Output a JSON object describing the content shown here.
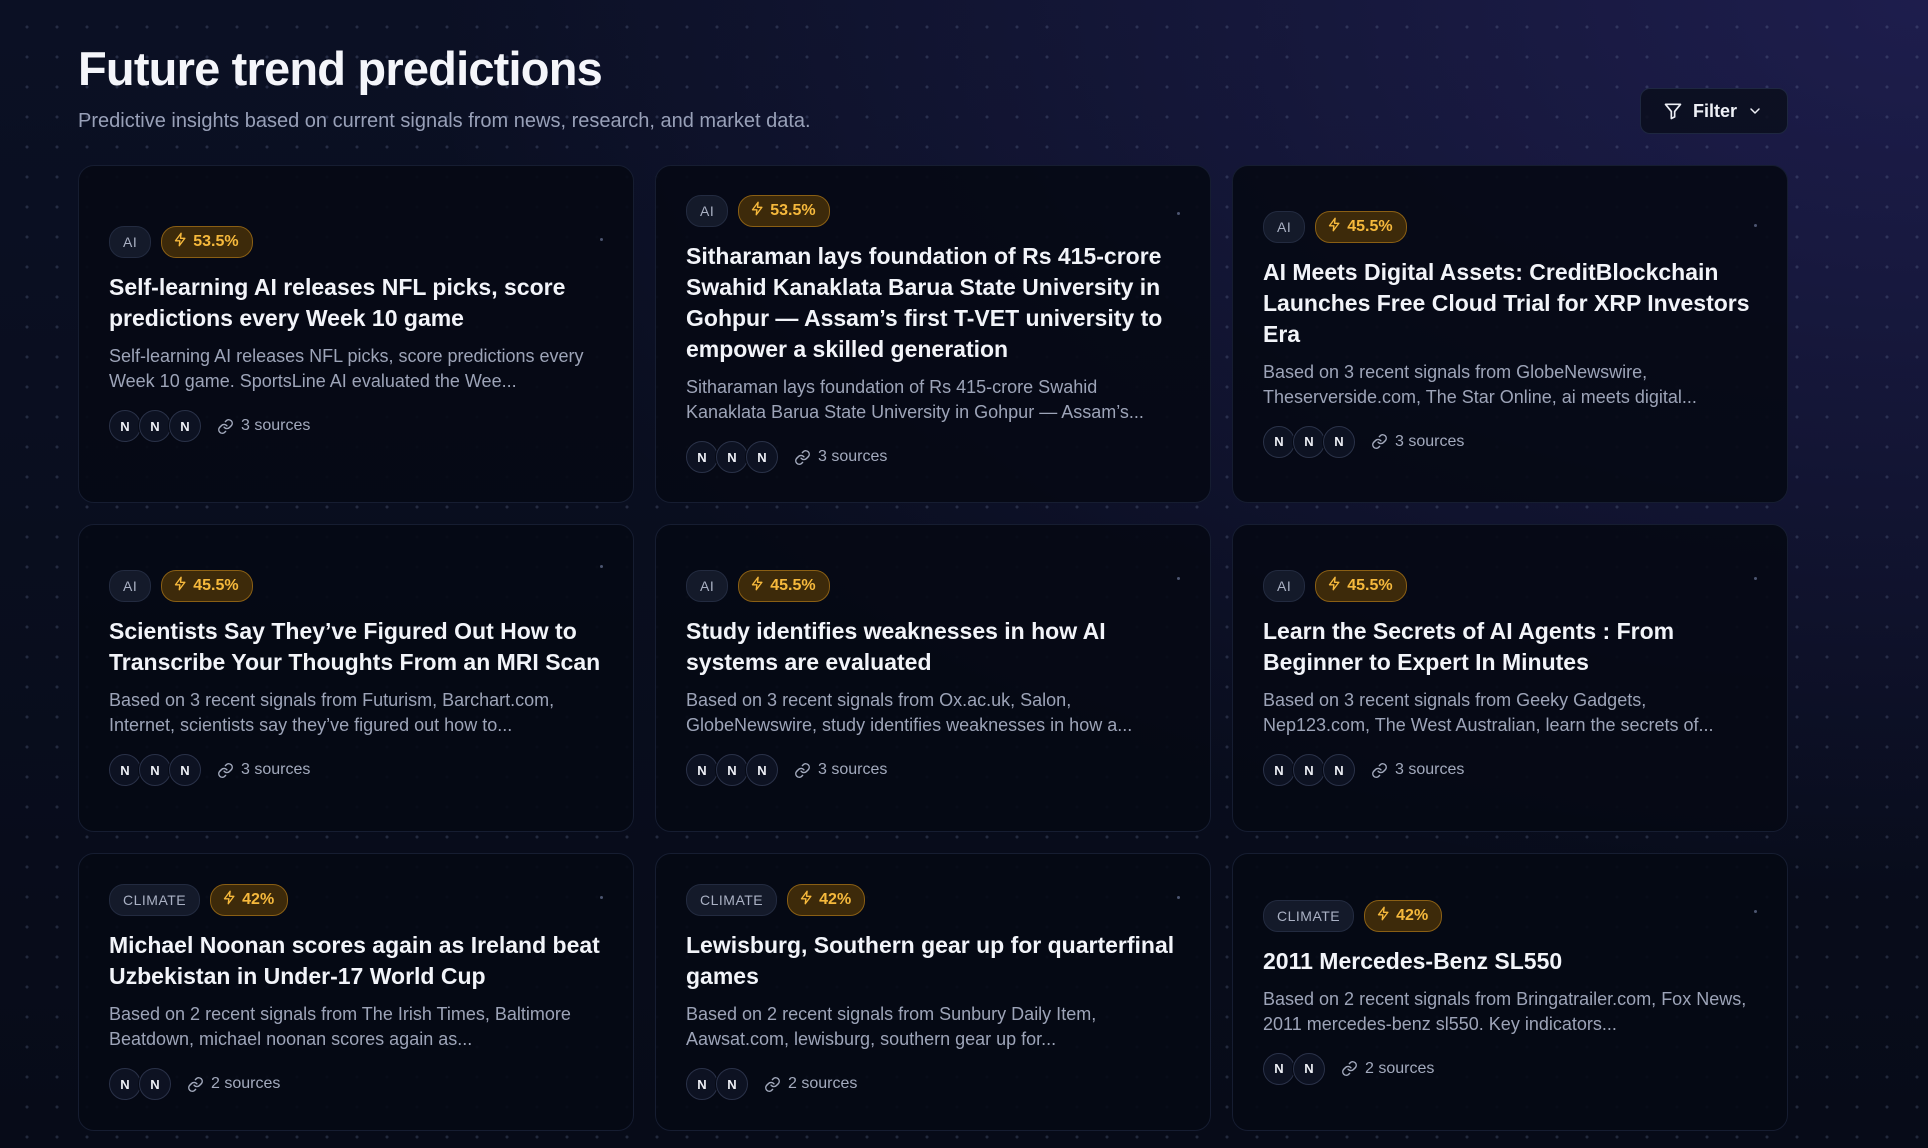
{
  "header": {
    "title": "Future trend predictions",
    "subtitle": "Predictive insights based on current signals from news, research, and market data.",
    "filter_label": "Filter"
  },
  "colors": {
    "background": "#070b17",
    "card": "#060914",
    "score_badge_text": "#f6b93c",
    "score_badge_bg": "#3d2a0a"
  },
  "cards": [
    {
      "category": "AI",
      "score": "53.5%",
      "title": "Self-learning AI releases NFL picks, score predictions every Week 10 game",
      "summary": "Self-learning AI releases NFL picks, score predictions every Week 10 game. SportsLine AI evaluated the Wee...",
      "avatars": [
        "N",
        "N",
        "N"
      ],
      "sources": "3 sources"
    },
    {
      "category": "AI",
      "score": "53.5%",
      "title": "Sitharaman lays foundation of Rs 415-crore Swahid Kanaklata Barua State University in Gohpur — Assam’s first T-VET university to empower a skilled generation",
      "summary": "Sitharaman lays foundation of Rs 415-crore Swahid Kanaklata Barua State University in Gohpur — Assam’s...",
      "avatars": [
        "N",
        "N",
        "N"
      ],
      "sources": "3 sources"
    },
    {
      "category": "AI",
      "score": "45.5%",
      "title": "AI Meets Digital Assets: CreditBlockchain Launches Free Cloud Trial for XRP Investors Era",
      "summary": "Based on 3 recent signals from GlobeNewswire, Theserverside.com, The Star Online, ai meets digital...",
      "avatars": [
        "N",
        "N",
        "N"
      ],
      "sources": "3 sources"
    },
    {
      "category": "AI",
      "score": "45.5%",
      "title": "Scientists Say They’ve Figured Out How to Transcribe Your Thoughts From an MRI Scan",
      "summary": "Based on 3 recent signals from Futurism, Barchart.com, Internet, scientists say they’ve figured out how to...",
      "avatars": [
        "N",
        "N",
        "N"
      ],
      "sources": "3 sources"
    },
    {
      "category": "AI",
      "score": "45.5%",
      "title": "Study identifies weaknesses in how AI systems are evaluated",
      "summary": "Based on 3 recent signals from Ox.ac.uk, Salon, GlobeNewswire, study identifies weaknesses in how a...",
      "avatars": [
        "N",
        "N",
        "N"
      ],
      "sources": "3 sources"
    },
    {
      "category": "AI",
      "score": "45.5%",
      "title": "Learn the Secrets of AI Agents : From Beginner to Expert In Minutes",
      "summary": "Based on 3 recent signals from Geeky Gadgets, Nep123.com, The West Australian, learn the secrets of...",
      "avatars": [
        "N",
        "N",
        "N"
      ],
      "sources": "3 sources"
    },
    {
      "category": "CLIMATE",
      "score": "42%",
      "title": "Michael Noonan scores again as Ireland beat Uzbekistan in Under-17 World Cup",
      "summary": "Based on 2 recent signals from The Irish Times, Baltimore Beatdown, michael noonan scores again as...",
      "avatars": [
        "N",
        "N"
      ],
      "sources": "2 sources"
    },
    {
      "category": "CLIMATE",
      "score": "42%",
      "title": "Lewisburg, Southern gear up for quarterfinal games",
      "summary": "Based on 2 recent signals from Sunbury Daily Item, Aawsat.com, lewisburg, southern gear up for...",
      "avatars": [
        "N",
        "N"
      ],
      "sources": "2 sources"
    },
    {
      "category": "CLIMATE",
      "score": "42%",
      "title": "2011 Mercedes-Benz SL550",
      "summary": "Based on 2 recent signals from Bringatrailer.com, Fox News, 2011 mercedes-benz sl550. Key indicators...",
      "avatars": [
        "N",
        "N"
      ],
      "sources": "2 sources"
    }
  ]
}
